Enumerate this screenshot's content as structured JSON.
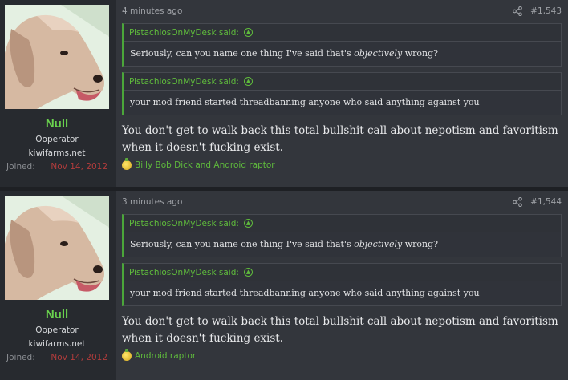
{
  "posts": [
    {
      "user": {
        "name": "Null",
        "title": "Ooperator",
        "site": "kiwifarms.net",
        "joined_label": "Joined:",
        "joined_date": "Nov 14, 2012"
      },
      "time": "4 minutes ago",
      "number": "#1,543",
      "quotes": [
        {
          "author": "PistachiosOnMyDesk said:",
          "before": "Seriously, can you name one thing I've said that's ",
          "emph": "objectively",
          "after": " wrong?"
        },
        {
          "author": "PistachiosOnMyDesk said:",
          "before": "your mod friend started threadbanning anyone who said anything against you",
          "emph": "",
          "after": ""
        }
      ],
      "message_line1": "You don't get to walk back this total bullshit call about nepotism and favoritism",
      "message_line2": "when it doesn't fucking exist.",
      "reactions": "Billy Bob Dick and Android raptor"
    },
    {
      "user": {
        "name": "Null",
        "title": "Ooperator",
        "site": "kiwifarms.net",
        "joined_label": "Joined:",
        "joined_date": "Nov 14, 2012"
      },
      "time": "3 minutes ago",
      "number": "#1,544",
      "quotes": [
        {
          "author": "PistachiosOnMyDesk said:",
          "before": "Seriously, can you name one thing I've said that's ",
          "emph": "objectively",
          "after": " wrong?"
        },
        {
          "author": "PistachiosOnMyDesk said:",
          "before": "your mod friend started threadbanning anyone who said anything against you",
          "emph": "",
          "after": ""
        }
      ],
      "message_line1": "You don't get to walk back this total bullshit call about nepotism and favoritism",
      "message_line2": "when it doesn't fucking exist.",
      "reactions": "Android raptor"
    }
  ],
  "colors": {
    "username": "#6ad24e",
    "quote_accent": "#4ba63a",
    "joined_date": "#b23c3c"
  },
  "icons": {
    "share": "share-icon",
    "quote_jump": "arrow-up-circle-icon",
    "reaction": "reaction-icon"
  }
}
